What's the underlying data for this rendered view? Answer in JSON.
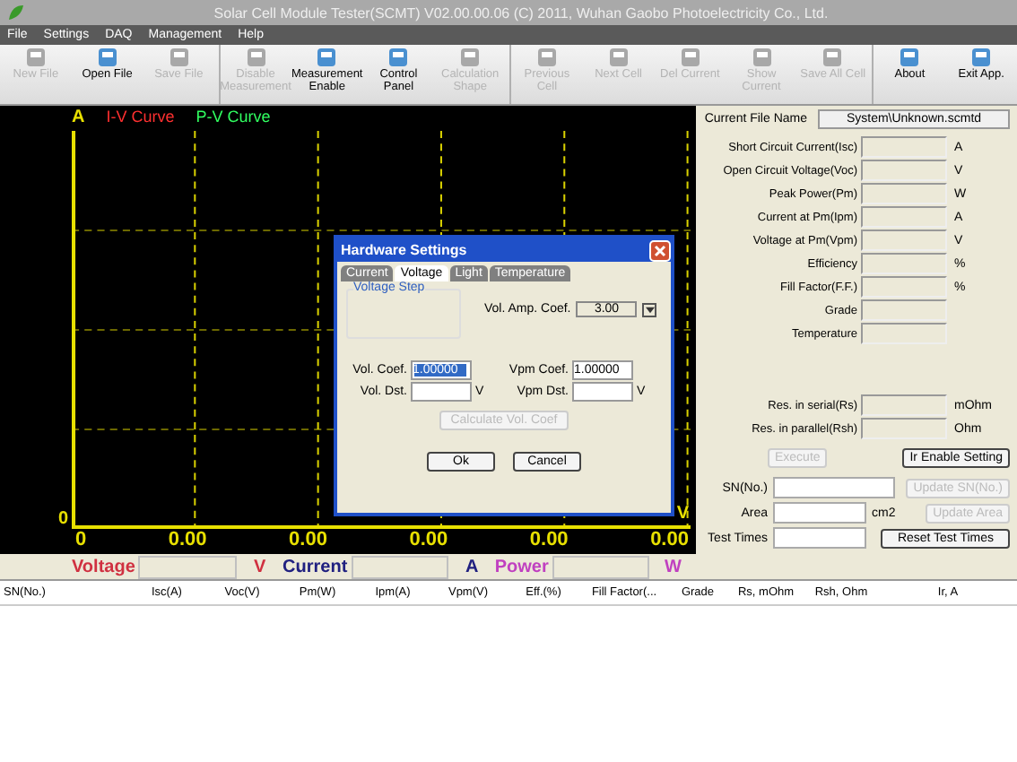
{
  "window": {
    "title": "Solar Cell Module Tester(SCMT) V02.00.00.06 (C) 2011, Wuhan Gaobo Photoelectricity Co., Ltd."
  },
  "menu": [
    "File",
    "Settings",
    "DAQ",
    "Management",
    "Help"
  ],
  "toolbar": [
    {
      "label": "New File",
      "disabled": true,
      "group_start": false
    },
    {
      "label": "Open File",
      "disabled": false,
      "group_start": false
    },
    {
      "label": "Save File",
      "disabled": true,
      "group_start": false
    },
    {
      "label": "Disable Measurement",
      "disabled": true,
      "group_start": true
    },
    {
      "label": "Measurement Enable",
      "disabled": false,
      "group_start": false
    },
    {
      "label": "Control Panel",
      "disabled": false,
      "group_start": false
    },
    {
      "label": "Calculation Shape",
      "disabled": true,
      "group_start": false
    },
    {
      "label": "Previous Cell",
      "disabled": true,
      "group_start": true
    },
    {
      "label": "Next Cell",
      "disabled": true,
      "group_start": false
    },
    {
      "label": "Del Current",
      "disabled": true,
      "group_start": false
    },
    {
      "label": "Show Current",
      "disabled": true,
      "group_start": false
    },
    {
      "label": "Save All Cell",
      "disabled": true,
      "group_start": false
    },
    {
      "label": "About",
      "disabled": false,
      "group_start": true
    },
    {
      "label": "Exit App.",
      "disabled": false,
      "group_start": false
    }
  ],
  "chart": {
    "y_unit": "A",
    "x_unit": "V",
    "y_tick": "0",
    "legend": [
      {
        "label": "I-V Curve",
        "color": "#ff3030"
      },
      {
        "label": "P-V Curve",
        "color": "#30ff60"
      }
    ],
    "x_ticks": [
      "0",
      "0.00",
      "0.00",
      "0.00",
      "0.00",
      "0.00"
    ]
  },
  "readings": [
    {
      "label": "Voltage",
      "unit": "V",
      "color": "#d03040"
    },
    {
      "label": "Current",
      "unit": "A",
      "color": "#202080"
    },
    {
      "label": "Power",
      "unit": "W",
      "color": "#c040c0"
    }
  ],
  "panel": {
    "file_label": "Current File Name",
    "file_value": "System\\Unknown.scmtd",
    "results": [
      {
        "label": "Short Circuit Current(Isc)",
        "unit": "A"
      },
      {
        "label": "Open Circuit Voltage(Voc)",
        "unit": "V"
      },
      {
        "label": "Peak Power(Pm)",
        "unit": "W"
      },
      {
        "label": "Current at Pm(Ipm)",
        "unit": "A"
      },
      {
        "label": "Voltage at Pm(Vpm)",
        "unit": "V"
      },
      {
        "label": "Efficiency",
        "unit": "%"
      },
      {
        "label": "Fill Factor(F.F.)",
        "unit": "%"
      },
      {
        "label": "Grade"
      },
      {
        "label": "Temperature"
      }
    ],
    "resistances": [
      {
        "label": "Res. in serial(Rs)",
        "unit": "mOhm"
      },
      {
        "label": "Res. in parallel(Rsh)",
        "unit": "Ohm"
      }
    ],
    "execute": {
      "label": "Execute",
      "disabled": true
    },
    "ir_button": {
      "label": "Ir Enable Setting",
      "disabled": false
    },
    "sn": {
      "label": "SN(No.)",
      "button": "Update SN(No.)",
      "disabled": true
    },
    "area": {
      "label": "Area",
      "unit": "cm2",
      "button": "Update Area",
      "disabled": true
    },
    "test_times": {
      "label": "Test Times",
      "button": "Reset Test Times"
    }
  },
  "table": {
    "columns": [
      "SN(No.)",
      "Isc(A)",
      "Voc(V)",
      "Pm(W)",
      "Ipm(A)",
      "Vpm(V)",
      "Eff.(%)",
      "Fill Factor(...",
      "Grade",
      "Rs, mOhm",
      "Rsh, Ohm",
      "Ir, A"
    ]
  },
  "dialog": {
    "title": "Hardware Settings",
    "tabs": [
      {
        "label": "Current",
        "selected": false
      },
      {
        "label": "Voltage",
        "selected": true
      },
      {
        "label": "Light",
        "selected": false
      },
      {
        "label": "Temperature",
        "selected": false
      }
    ],
    "group": "Voltage Step",
    "amp_label": "Vol. Amp. Coef.",
    "amp_value": "3.00",
    "fields": [
      {
        "label": "Vol. Coef.",
        "value": "1.00000",
        "selected": true
      },
      {
        "label": "Vol. Dst.",
        "selected": false,
        "unit": "V"
      },
      {
        "label": "Vpm Coef.",
        "value": "1.00000",
        "selected": false
      },
      {
        "label": "Vpm Dst.",
        "selected": false,
        "unit": "V"
      }
    ],
    "calc": {
      "label": "Calculate Vol. Coef",
      "disabled": true
    },
    "buttons": [
      "Ok",
      "Cancel"
    ]
  }
}
